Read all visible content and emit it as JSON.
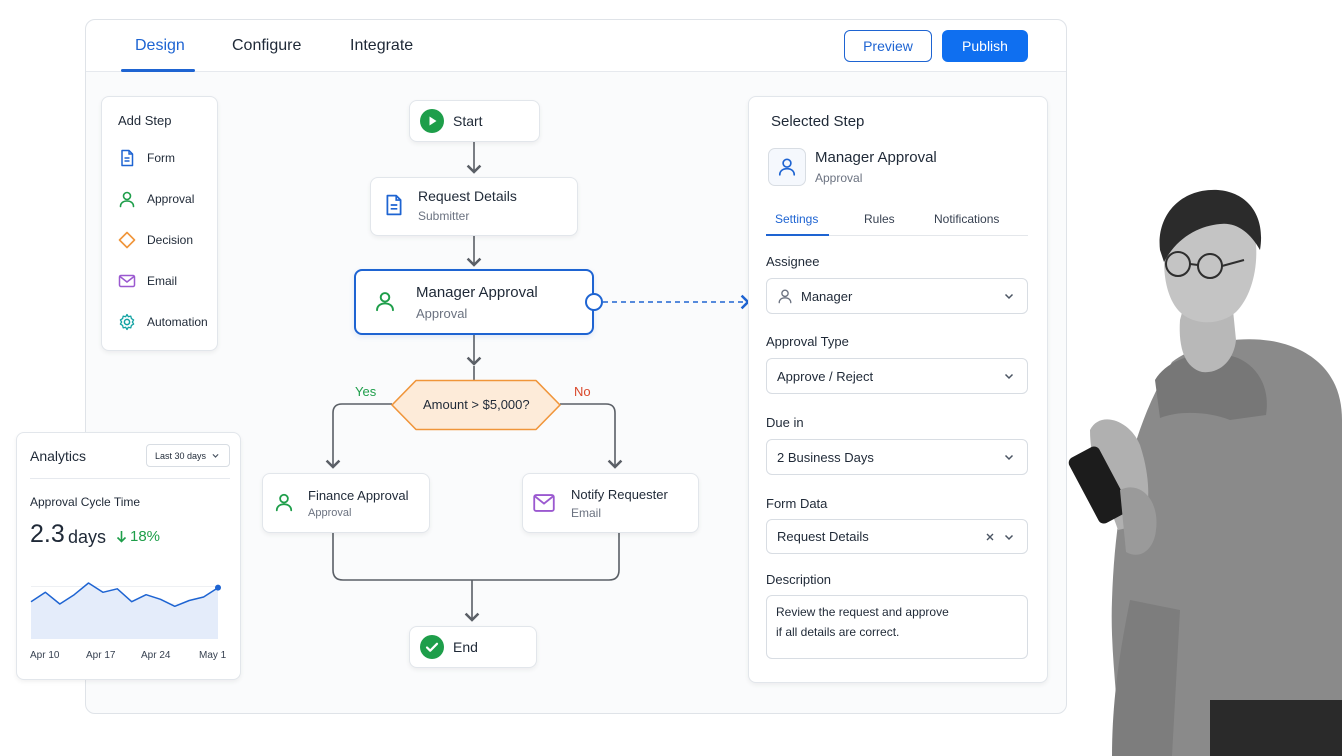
{
  "header": {
    "tabs": [
      {
        "label": "Design",
        "active": true
      },
      {
        "label": "Configure",
        "active": false
      },
      {
        "label": "Integrate",
        "active": false
      }
    ],
    "preview_label": "Preview",
    "publish_label": "Publish"
  },
  "add_step": {
    "title": "Add Step",
    "items": [
      {
        "label": "Form",
        "icon": "document-icon"
      },
      {
        "label": "Approval",
        "icon": "user-icon"
      },
      {
        "label": "Decision",
        "icon": "diamond-icon"
      },
      {
        "label": "Email",
        "icon": "envelope-icon"
      },
      {
        "label": "Automation",
        "icon": "gear-icon"
      }
    ]
  },
  "flow": {
    "start": "Start",
    "request": {
      "title": "Request Details",
      "sub": "Submitter"
    },
    "manager": {
      "title": "Manager Approval",
      "sub": "Approval"
    },
    "decision": {
      "label": "Amount > $5,000?",
      "yes": "Yes",
      "no": "No"
    },
    "finance": {
      "title": "Finance Approval",
      "sub": "Approval"
    },
    "notify": {
      "title": "Notify Requester",
      "sub": "Email"
    },
    "end": "End"
  },
  "panel": {
    "title": "Selected Step",
    "step_title": "Manager Approval",
    "step_sub": "Approval",
    "tabs": [
      {
        "label": "Settings",
        "active": true
      },
      {
        "label": "Rules",
        "active": false
      },
      {
        "label": "Notifications",
        "active": false
      }
    ],
    "assignee_label": "Assignee",
    "assignee_value": "Manager",
    "approval_type_label": "Approval Type",
    "approval_type_value": "Approve / Reject",
    "due_label": "Due in",
    "due_value": "2 Business Days",
    "form_data_label": "Form Data",
    "form_data_value": "Request Details",
    "description_label": "Description",
    "description_line1": "Review the request and approve",
    "description_line2": "if all details are correct."
  },
  "analytics": {
    "title": "Analytics",
    "range": "Last 30 days",
    "metric_label": "Approval Cycle Time",
    "metric_value": "2.3",
    "metric_unit": "days",
    "change": "18%",
    "x_labels": [
      "Apr 10",
      "Apr 17",
      "Apr 24",
      "May 1"
    ],
    "sparkline": [
      32,
      40,
      30,
      38,
      48,
      40,
      43,
      32,
      38,
      34,
      28,
      33,
      36,
      44
    ],
    "sparkline_range": [
      0,
      60
    ]
  },
  "colors": {
    "accent": "#1e64d2",
    "primary_button": "#0f6ff0",
    "success": "#1e9e4a",
    "decision_orange": "#f0953a",
    "email_purple": "#9b59d0",
    "automation_teal": "#13a3a3"
  }
}
